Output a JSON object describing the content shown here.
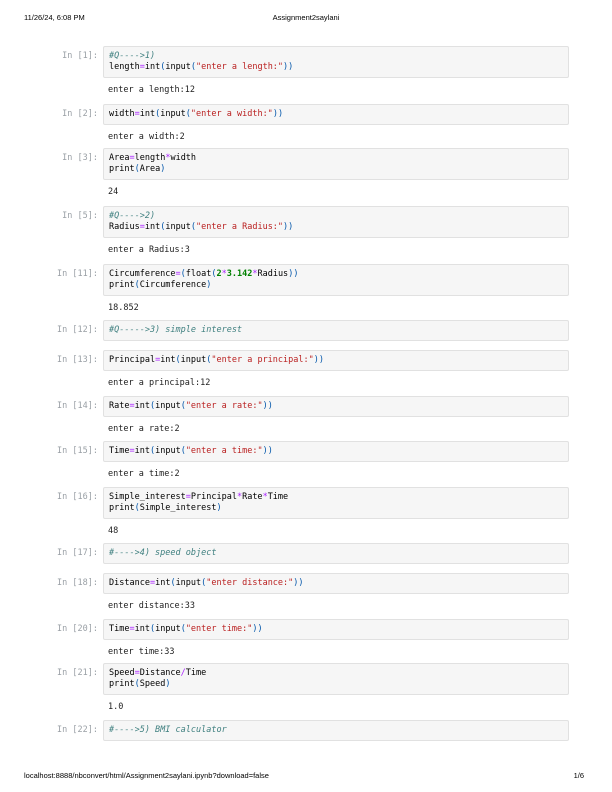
{
  "header": {
    "datetime": "11/26/24, 6:08 PM",
    "title": "Assignment2saylani"
  },
  "footer": {
    "url": "localhost:8888/nbconvert/html/Assignment2saylani.ipynb?download=false",
    "page": "1/6"
  },
  "cells": [
    {
      "prompt": "In [1]:",
      "lines": [
        "#Q---->1)",
        "length=int(input(\"enter a length:\"))"
      ],
      "output": "enter a length:12"
    },
    {
      "prompt": "In [2]:",
      "lines": [
        "width=int(input(\"enter a width:\"))"
      ],
      "output": "enter a width:2"
    },
    {
      "prompt": "In [3]:",
      "lines": [
        "Area=length*width",
        "print(Area)"
      ],
      "output": "24"
    },
    {
      "prompt": "In [5]:",
      "lines": [
        "#Q---->2)",
        "Radius=int(input(\"enter a Radius:\"))"
      ],
      "output": "enter a Radius:3"
    },
    {
      "prompt": "In [11]:",
      "lines": [
        "Circumference=(float(2*3.142*Radius))",
        "print(Circumference)"
      ],
      "output": "18.852"
    },
    {
      "prompt": "In [12]:",
      "lines": [
        "#Q----->3) simple interest"
      ],
      "output": ""
    },
    {
      "prompt": "In [13]:",
      "lines": [
        "Principal=int(input(\"enter a principal:\"))"
      ],
      "output": "enter a principal:12"
    },
    {
      "prompt": "In [14]:",
      "lines": [
        "Rate=int(input(\"enter a rate:\"))"
      ],
      "output": "enter a rate:2"
    },
    {
      "prompt": "In [15]:",
      "lines": [
        "Time=int(input(\"enter a time:\"))"
      ],
      "output": "enter a time:2"
    },
    {
      "prompt": "In [16]:",
      "lines": [
        "Simple_interest=Principal*Rate*Time",
        "print(Simple_interest)"
      ],
      "output": "48"
    },
    {
      "prompt": "In [17]:",
      "lines": [
        "#---->4) speed object"
      ],
      "output": ""
    },
    {
      "prompt": "In [18]:",
      "lines": [
        "Distance=int(input(\"enter distance:\"))"
      ],
      "output": "enter distance:33"
    },
    {
      "prompt": "In [20]:",
      "lines": [
        "Time=int(input(\"enter time:\"))"
      ],
      "output": "enter time:33"
    },
    {
      "prompt": "In [21]:",
      "lines": [
        "Speed=Distance/Time",
        "print(Speed)"
      ],
      "output": "1.0"
    },
    {
      "prompt": "In [22]:",
      "lines": [
        "#---->5) BMI calculator"
      ],
      "output": ""
    }
  ]
}
